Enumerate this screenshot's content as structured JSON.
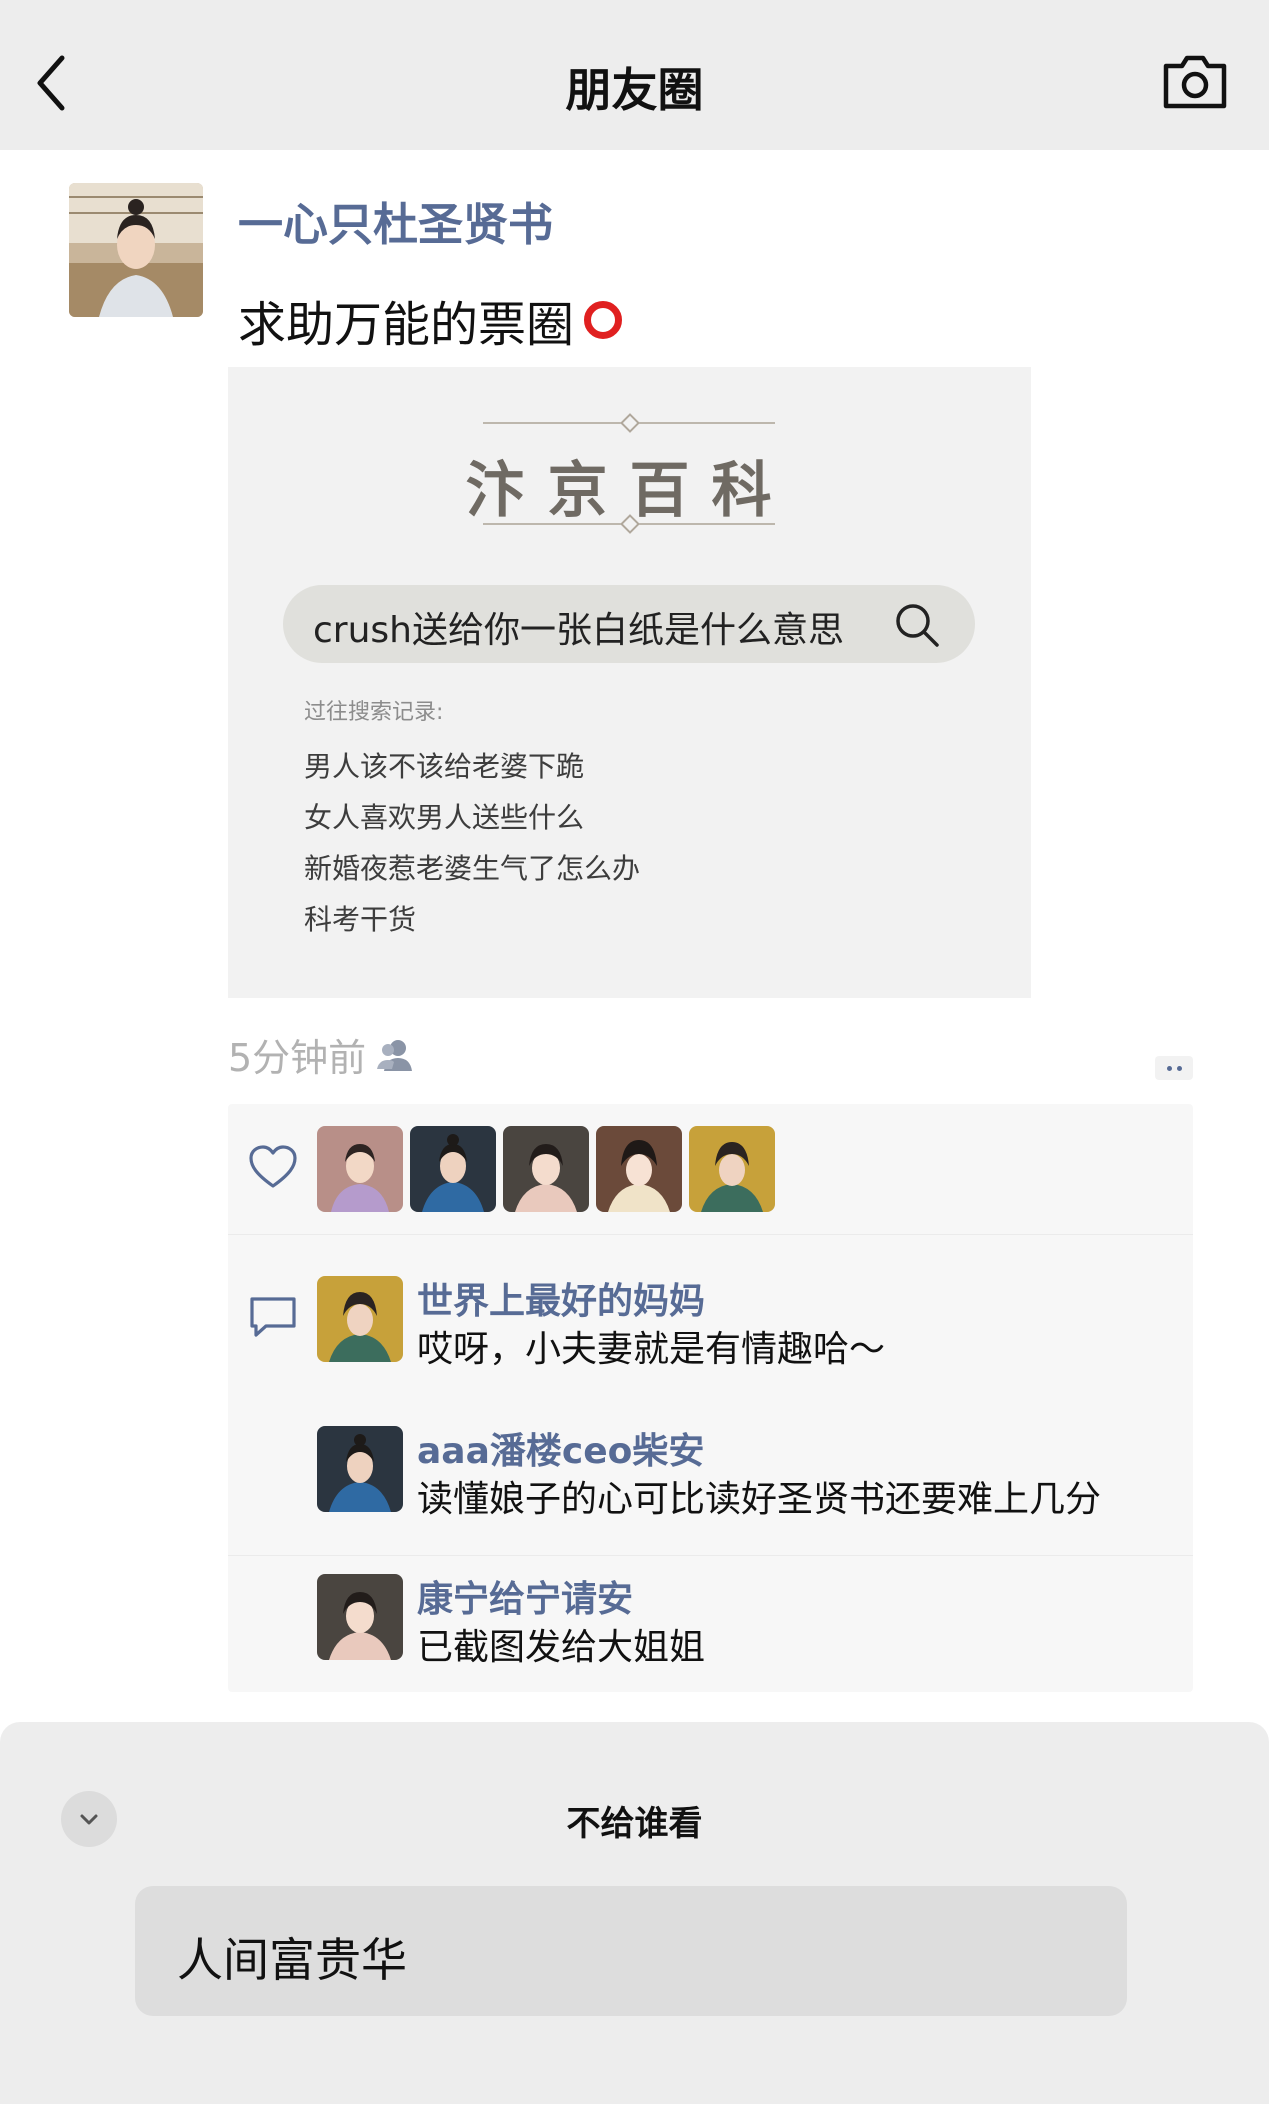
{
  "header": {
    "title": "朋友圈",
    "back_icon": "chevron-left-icon",
    "camera_icon": "camera-icon"
  },
  "post": {
    "author": "一心只杜圣贤书",
    "text": "求助万能的票圈",
    "time": "5分钟前",
    "image": {
      "title": "汴京百科",
      "search_query": "crush送给你一张白纸是什么意思",
      "history_label": "过往搜索记录:",
      "history": [
        "男人该不该给老婆下跪",
        "女人喜欢男人送些什么",
        "新婚夜惹老婆生气了怎么办",
        "科考干货"
      ]
    }
  },
  "comments": [
    {
      "name": "世界上最好的妈妈",
      "text": "哎呀，小夫妻就是有情趣哈～"
    },
    {
      "name": "aaa潘楼ceo柴安",
      "text": "读懂娘子的心可比读好圣贤书还要难上几分"
    },
    {
      "name": "康宁给宁请安",
      "text": "已截图发给大姐姐"
    }
  ],
  "visibility_sheet": {
    "title": "不给谁看",
    "selected": "人间富贵华"
  },
  "colors": {
    "link": "#576b95",
    "background": "#ffffff",
    "header_bg": "#ededed",
    "panel_bg": "#f7f7f7"
  }
}
